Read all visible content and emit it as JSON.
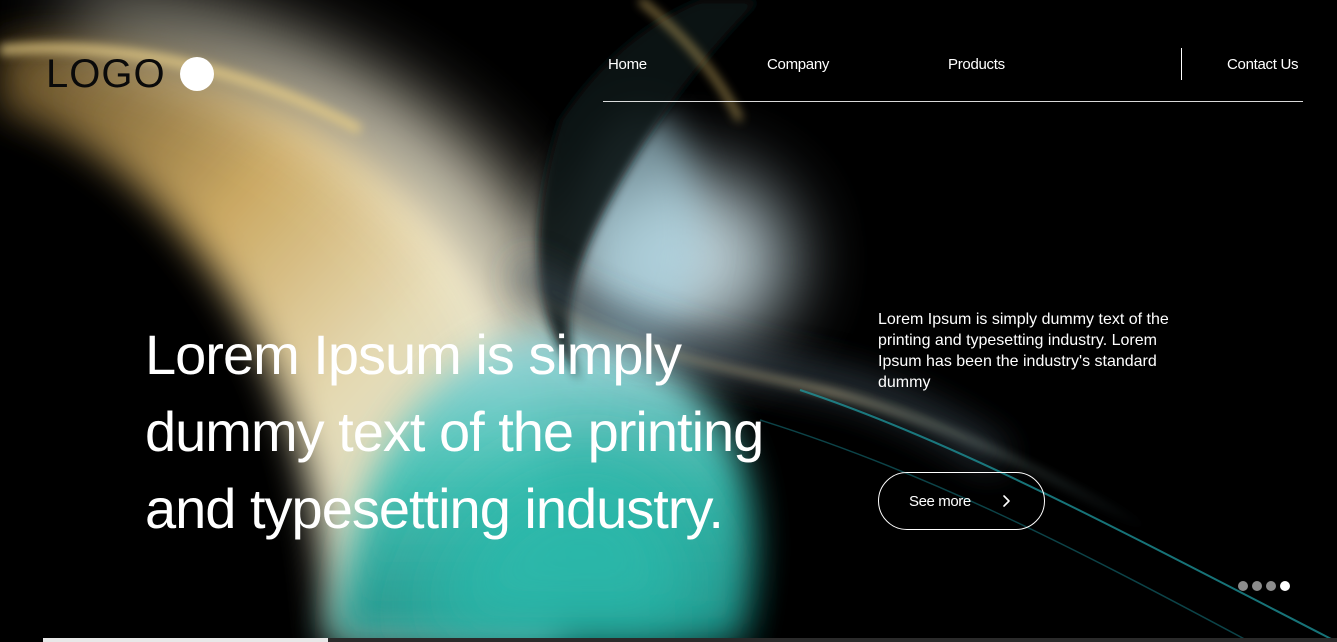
{
  "logo": {
    "text": "LOGO"
  },
  "nav": {
    "items": [
      {
        "label": "Home"
      },
      {
        "label": "Company"
      },
      {
        "label": "Products"
      },
      {
        "label": "Contact Us"
      }
    ]
  },
  "hero": {
    "headline": "Lorem Ipsum is simply dummy text of the printing and typesetting industry.",
    "description": "Lorem Ipsum is simply dummy text of the printing and typesetting industry. Lorem Ipsum has been the industry's standard dummy",
    "button_label": "See more",
    "button_icon": "chevron-right-icon"
  },
  "carousel": {
    "total_slides": 4,
    "active_slide": 4,
    "progress": 0.22
  },
  "colors": {
    "background": "#000000",
    "text": "#ffffff",
    "accent_teal": "#2bb7a9",
    "accent_gold": "#d9b867"
  }
}
